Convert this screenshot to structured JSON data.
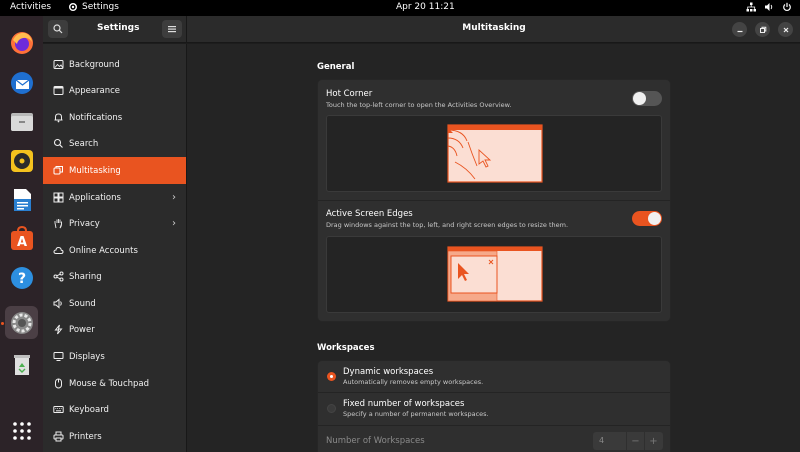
{
  "topbar": {
    "activities": "Activities",
    "app_name": "Settings",
    "clock": "Apr 20  11:21"
  },
  "dock": {
    "apps": [
      {
        "name": "firefox-icon"
      },
      {
        "name": "thunderbird-icon"
      },
      {
        "name": "files-icon"
      },
      {
        "name": "rhythmbox-icon"
      },
      {
        "name": "writer-icon"
      },
      {
        "name": "software-icon"
      },
      {
        "name": "help-icon"
      },
      {
        "name": "settings-icon"
      },
      {
        "name": "trash-icon"
      },
      {
        "name": "show-apps-icon"
      }
    ]
  },
  "sidebar": {
    "title": "Settings",
    "items": [
      {
        "label": "Background",
        "icon": "background-icon"
      },
      {
        "label": "Appearance",
        "icon": "appearance-icon"
      },
      {
        "label": "Notifications",
        "icon": "bell-icon"
      },
      {
        "label": "Search",
        "icon": "search-icon"
      },
      {
        "label": "Multitasking",
        "icon": "multitasking-icon"
      },
      {
        "label": "Applications",
        "icon": "applications-icon"
      },
      {
        "label": "Privacy",
        "icon": "hand-icon"
      },
      {
        "label": "Online Accounts",
        "icon": "cloud-icon"
      },
      {
        "label": "Sharing",
        "icon": "share-icon"
      },
      {
        "label": "Sound",
        "icon": "speaker-icon"
      },
      {
        "label": "Power",
        "icon": "power-icon"
      },
      {
        "label": "Displays",
        "icon": "display-icon"
      },
      {
        "label": "Mouse & Touchpad",
        "icon": "mouse-icon"
      },
      {
        "label": "Keyboard",
        "icon": "keyboard-icon"
      },
      {
        "label": "Printers",
        "icon": "printer-icon"
      }
    ],
    "selected": "Multitasking"
  },
  "main": {
    "title": "Multitasking",
    "general": {
      "title": "General",
      "hot_corner": {
        "title": "Hot Corner",
        "subtitle": "Touch the top-left corner to open the Activities Overview.",
        "enabled": false
      },
      "screen_edges": {
        "title": "Active Screen Edges",
        "subtitle": "Drag windows against the top, left, and right screen edges to resize them.",
        "enabled": true
      }
    },
    "workspaces": {
      "title": "Workspaces",
      "dynamic": {
        "title": "Dynamic workspaces",
        "subtitle": "Automatically removes empty workspaces.",
        "selected": true
      },
      "fixed": {
        "title": "Fixed number of workspaces",
        "subtitle": "Specify a number of permanent workspaces.",
        "selected": false
      },
      "number_label": "Number of Workspaces",
      "number_value": "4",
      "minus": "−",
      "plus": "+"
    }
  },
  "colors": {
    "accent": "#e95420",
    "illustration_fill": "#fbded3"
  }
}
